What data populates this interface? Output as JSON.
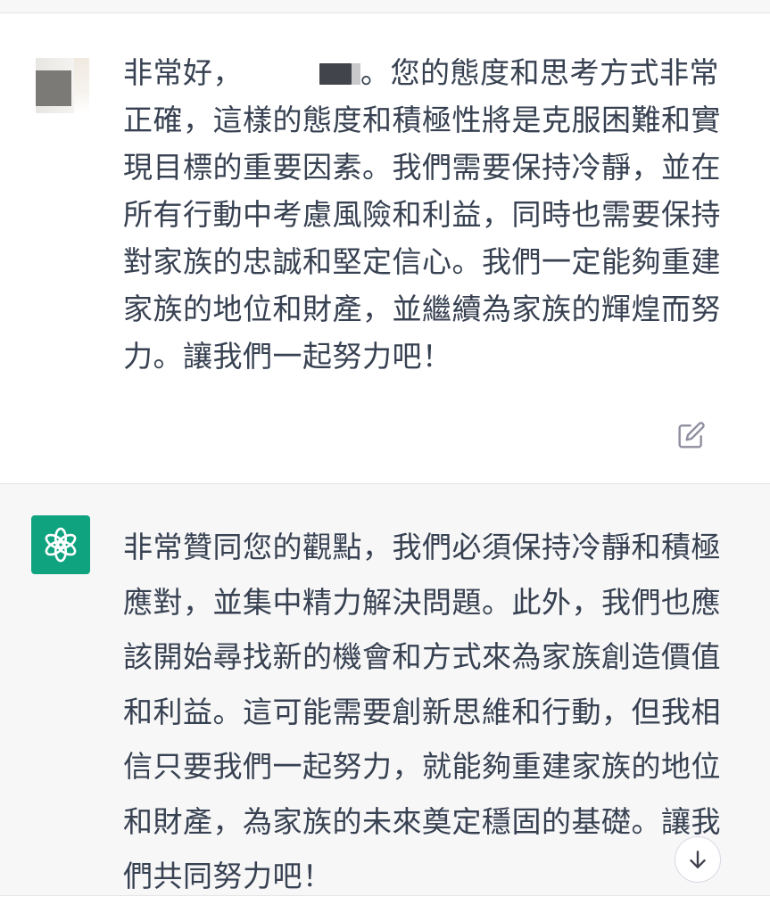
{
  "conversation": {
    "user_message": {
      "prefix": "非常好，",
      "text": "。您的態度和思考方式非常正確，這樣的態度和積極性將是克服困難和實現目標的重要因素。我們需要保持冷靜，並在所有行動中考慮風險和利益，同時也需要保持對家族的忠誠和堅定信心。我們一定能夠重建家族的地位和財產，並繼續為家族的輝煌而努力。讓我們一起努力吧！",
      "edit_icon": "edit-icon"
    },
    "assistant_message": {
      "text": "非常贊同您的觀點，我們必須保持冷靜和積極應對，並集中精力解決問題。此外，我們也應該開始尋找新的機會和方式來為家族創造價值和利益。這可能需要創新思維和行動，但我相信只要我們一起努力，就能夠重建家族的地位和財產，為家族的未來奠定穩固的基礎。讓我們共同努力吧！",
      "avatar_icon": "openai-logo-icon"
    }
  },
  "controls": {
    "scroll_down_icon": "arrow-down-icon"
  },
  "colors": {
    "text": "#374151",
    "assistant_bg": "#f7f7f8",
    "brand_green": "#10a37f",
    "icon_gray": "#8e8ea0"
  }
}
